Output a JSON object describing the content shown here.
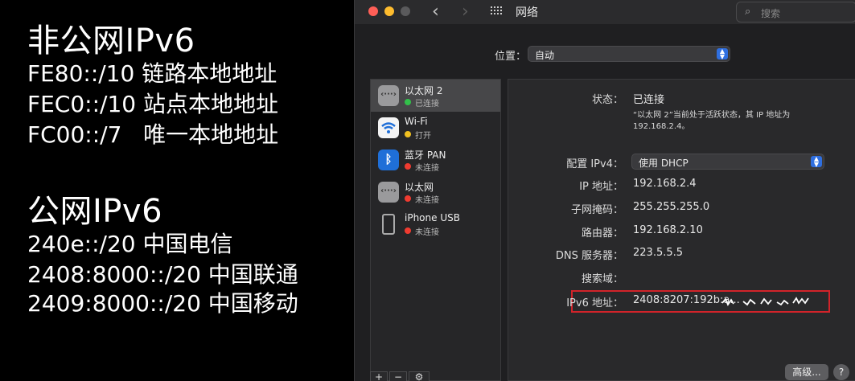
{
  "slide": {
    "heading1": "非公网IPv6",
    "lines1": [
      "FE80::/10 链路本地地址",
      "FEC0::/10 站点本地地址",
      "FC00::/7   唯一本地地址"
    ],
    "heading2": "公网IPv6",
    "lines2": [
      "240e::/20 中国电信",
      "2408:8000::/20 中国联通",
      "2409:8000::/20 中国移动"
    ]
  },
  "window": {
    "title": "网络",
    "search_placeholder": "搜索",
    "location_label": "位置：",
    "location_value": "自动"
  },
  "services": [
    {
      "name": "以太网 2",
      "status": "已连接",
      "status_color": "#32c04a",
      "icon": "ethernet-icon",
      "selected": true
    },
    {
      "name": "Wi-Fi",
      "status": "打开",
      "status_color": "#f0c020",
      "icon": "wifi-icon",
      "selected": false
    },
    {
      "name": "蓝牙 PAN",
      "status": "未连接",
      "status_color": "#f03b30",
      "icon": "bluetooth-icon",
      "selected": false
    },
    {
      "name": "以太网",
      "status": "未连接",
      "status_color": "#f03b30",
      "icon": "ethernet-icon",
      "selected": false
    },
    {
      "name": "iPhone USB",
      "status": "未连接",
      "status_color": "#f03b30",
      "icon": "iphone-icon",
      "selected": false
    }
  ],
  "sidebar_buttons": [
    "+",
    "−",
    "⚙"
  ],
  "detail": {
    "status_label": "状态：",
    "status_value": "已连接",
    "status_desc": "“以太网 2”当前处于活跃状态，其 IP 地址为 192.168.2.4。",
    "ipv4_label": "配置 IPv4：",
    "ipv4_value": "使用 DHCP",
    "ip_label": "IP 地址：",
    "ip_value": "192.168.2.4",
    "mask_label": "子网掩码：",
    "mask_value": "255.255.255.0",
    "router_label": "路由器：",
    "router_value": "192.168.2.10",
    "dns_label": "DNS 服务器：",
    "dns_value": "223.5.5.5",
    "search_domain_label": "搜索域：",
    "ipv6_label": "IPv6 地址：",
    "ipv6_value": "2408:8207:192b:a...",
    "advanced_label": "高级...",
    "help_label": "?"
  },
  "colors": {
    "highlight_box": "#d2232a",
    "accent": "#2f6fe0"
  }
}
